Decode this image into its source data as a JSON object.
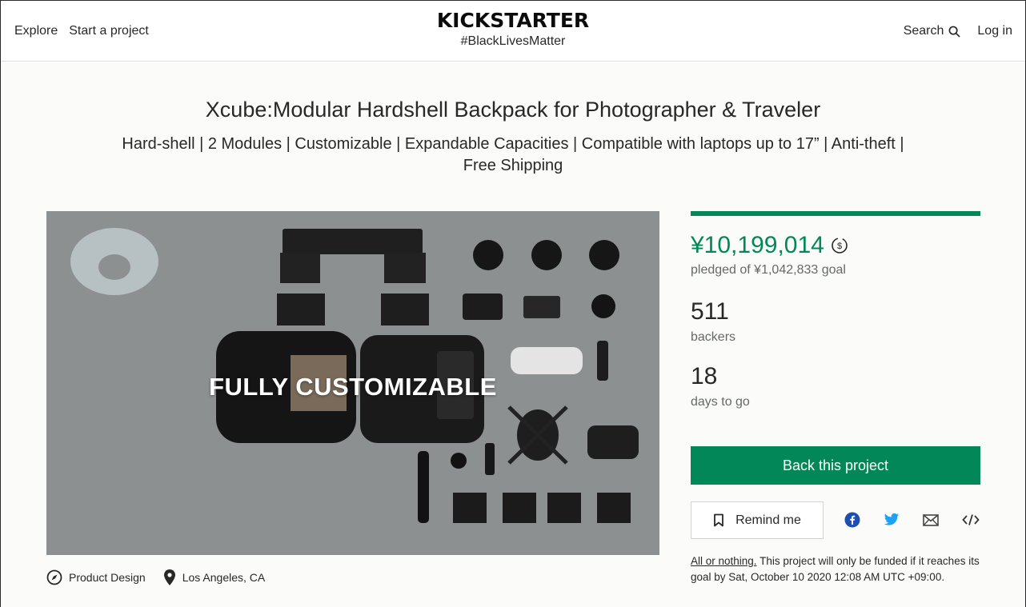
{
  "header": {
    "nav_left": [
      "Explore",
      "Start a project"
    ],
    "logo_text": "KICKSTARTER",
    "tagline": "#BlackLivesMatter",
    "search_label": "Search",
    "login_label": "Log in"
  },
  "project": {
    "title": "Xcube:Modular Hardshell Backpack for Photographer & Traveler",
    "blurb": "Hard-shell | 2 Modules | Customizable | Expandable Capacities | Compatible with laptops up to 17” | Anti-theft | Free Shipping",
    "hero_overlay": "FULLY CUSTOMIZABLE",
    "category": "Product Design",
    "location": "Los Angeles, CA"
  },
  "stats": {
    "pledged": "¥10,199,014",
    "goal_text": "pledged of ¥1,042,833 goal",
    "funded_fraction": 1.0,
    "backers_count": "511",
    "backers_label": "backers",
    "days_count": "18",
    "days_label": "days to go"
  },
  "actions": {
    "back_label": "Back this project",
    "remind_label": "Remind me",
    "share_icons": [
      "facebook-icon",
      "twitter-icon",
      "email-icon",
      "embed-icon"
    ]
  },
  "notice": {
    "link_text": "All or nothing.",
    "text": " This project will only be funded if it reaches its goal by Sat, October 10 2020 12:08 AM UTC +09:00."
  },
  "colors": {
    "accent_green": "#028858",
    "facebook": "#1e4fb0",
    "twitter": "#1da1f2"
  }
}
